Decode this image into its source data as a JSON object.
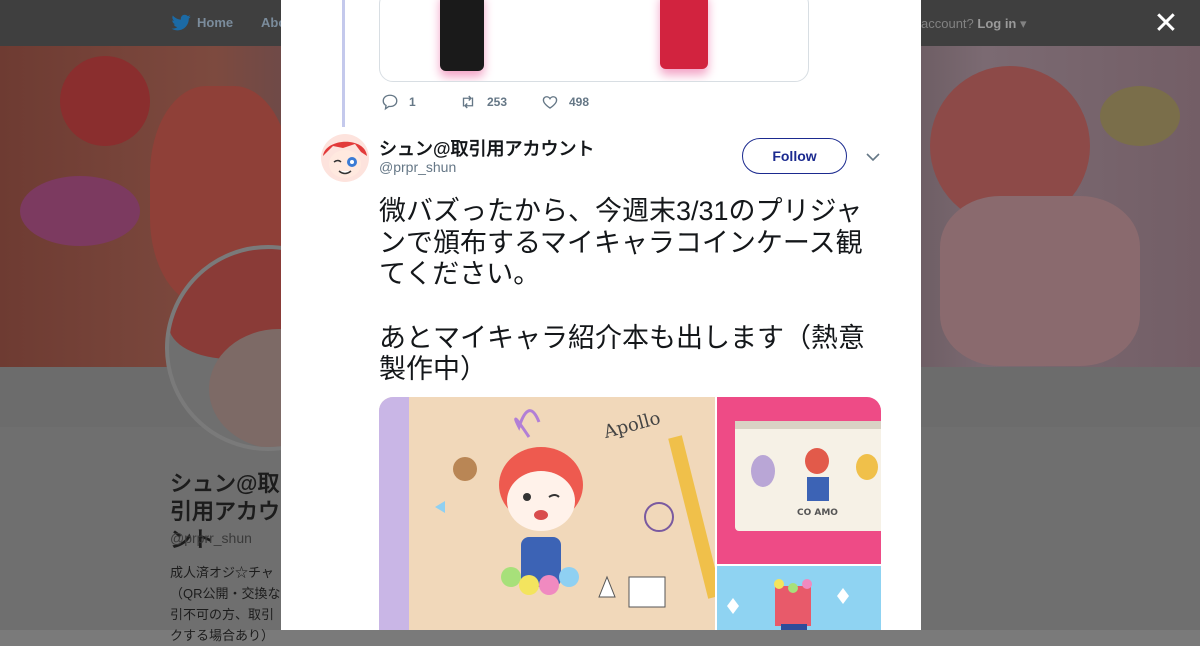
{
  "background_page": {
    "nav": {
      "home_label": "Home",
      "about_label": "Abo",
      "account_prompt": "account?",
      "login_label": "Log in"
    },
    "profile": {
      "name": "シュン@取引用アカウント",
      "handle": "@prprr_shun",
      "bio": "成人済オジ☆チャ（QR公開・交換な引不可の方、取引クする場合あり）"
    }
  },
  "modal": {
    "previous_tweet": {
      "reply_count": "1",
      "retweet_count": "253",
      "like_count": "498"
    },
    "tweet": {
      "author_name": "シュン@取引用アカウント",
      "author_handle": "@prpr_shun",
      "follow_label": "Follow",
      "text_paragraph_1": "微バズったから、今週末3/31のプリジャンで頒布するマイキャラコインケース観てください。",
      "text_paragraph_2": "あとマイキャラ紹介本も出します（熱意製作中）",
      "media_signature": "Apollo",
      "pouch_print": "CO AMO"
    }
  },
  "icons": [
    "twitter-bird-icon",
    "close-icon",
    "reply-icon",
    "retweet-icon",
    "like-icon",
    "chevron-down-icon"
  ],
  "colors": {
    "follow_accent": "#1b2a8f",
    "thread_line": "#c4c9ec",
    "action_gray": "#657786"
  }
}
